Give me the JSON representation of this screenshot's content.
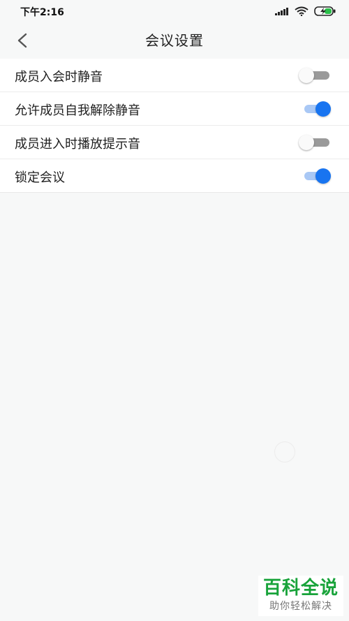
{
  "status_bar": {
    "time": "下午2:16"
  },
  "header": {
    "title": "会议设置",
    "back_icon": "chevron-left-icon"
  },
  "settings": [
    {
      "label": "成员入会时静音",
      "enabled": false
    },
    {
      "label": "允许成员自我解除静音",
      "enabled": true
    },
    {
      "label": "成员进入时播放提示音",
      "enabled": false
    },
    {
      "label": "锁定会议",
      "enabled": true
    }
  ],
  "watermark": {
    "main": "百科全说",
    "sub": "助你轻松解决"
  },
  "colors": {
    "accent": "#1874f0",
    "accent_track": "#a9c8f5",
    "off_track": "#9a9a9a",
    "watermark_green": "#18a33a"
  }
}
